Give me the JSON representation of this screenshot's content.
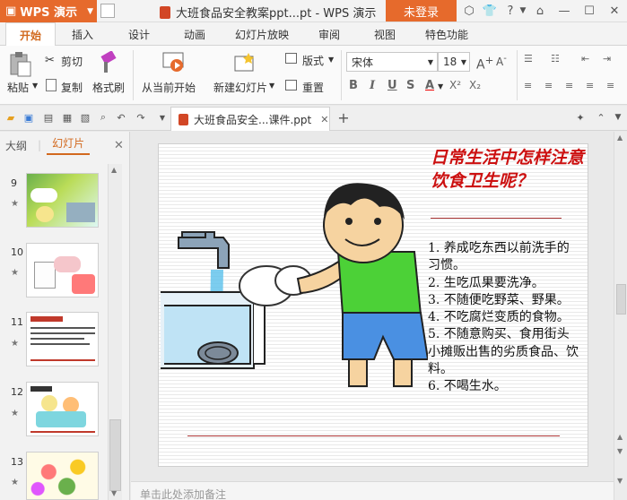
{
  "titlebar": {
    "app_name": "WPS 演示",
    "doc_title": "大班食品安全教案ppt...pt - WPS 演示",
    "login_label": "未登录"
  },
  "menu": {
    "tabs": [
      "开始",
      "插入",
      "设计",
      "动画",
      "幻灯片放映",
      "审阅",
      "视图",
      "特色功能"
    ]
  },
  "ribbon": {
    "paste": "粘贴",
    "cut": "剪切",
    "copy": "复制",
    "format_painter": "格式刷",
    "from_current": "从当前开始",
    "new_slide": "新建幻灯片",
    "layout": "版式",
    "reset": "重置",
    "font_name": "宋体",
    "font_size": "18",
    "bold": "B",
    "italic": "I",
    "underline": "U",
    "strike": "S",
    "font_color": "A",
    "superscript": "X²",
    "subscript": "X₂"
  },
  "doc_tab": {
    "label": "大班食品安全...课件.ppt"
  },
  "left_panel": {
    "outline_tab": "大纲",
    "slides_tab": "幻灯片",
    "slides": [
      {
        "num": "9"
      },
      {
        "num": "10"
      },
      {
        "num": "11"
      },
      {
        "num": "12"
      },
      {
        "num": "13"
      }
    ]
  },
  "slide": {
    "title": "日常生活中怎样注意饮食卫生呢？",
    "items": [
      "1. 养成吃东西以前洗手的习惯。",
      "2. 生吃瓜果要洗净。",
      "3. 不随便吃野菜、野果。",
      "4. 不吃腐烂变质的食物。",
      "5. 不随意购买、食用街头小摊贩出售的劣质食品、饮料。",
      "6. 不喝生水。"
    ]
  },
  "notes": {
    "placeholder": "单击此处添加备注"
  },
  "colors": {
    "accent": "#e66a2c",
    "title_red": "#cc1010"
  }
}
